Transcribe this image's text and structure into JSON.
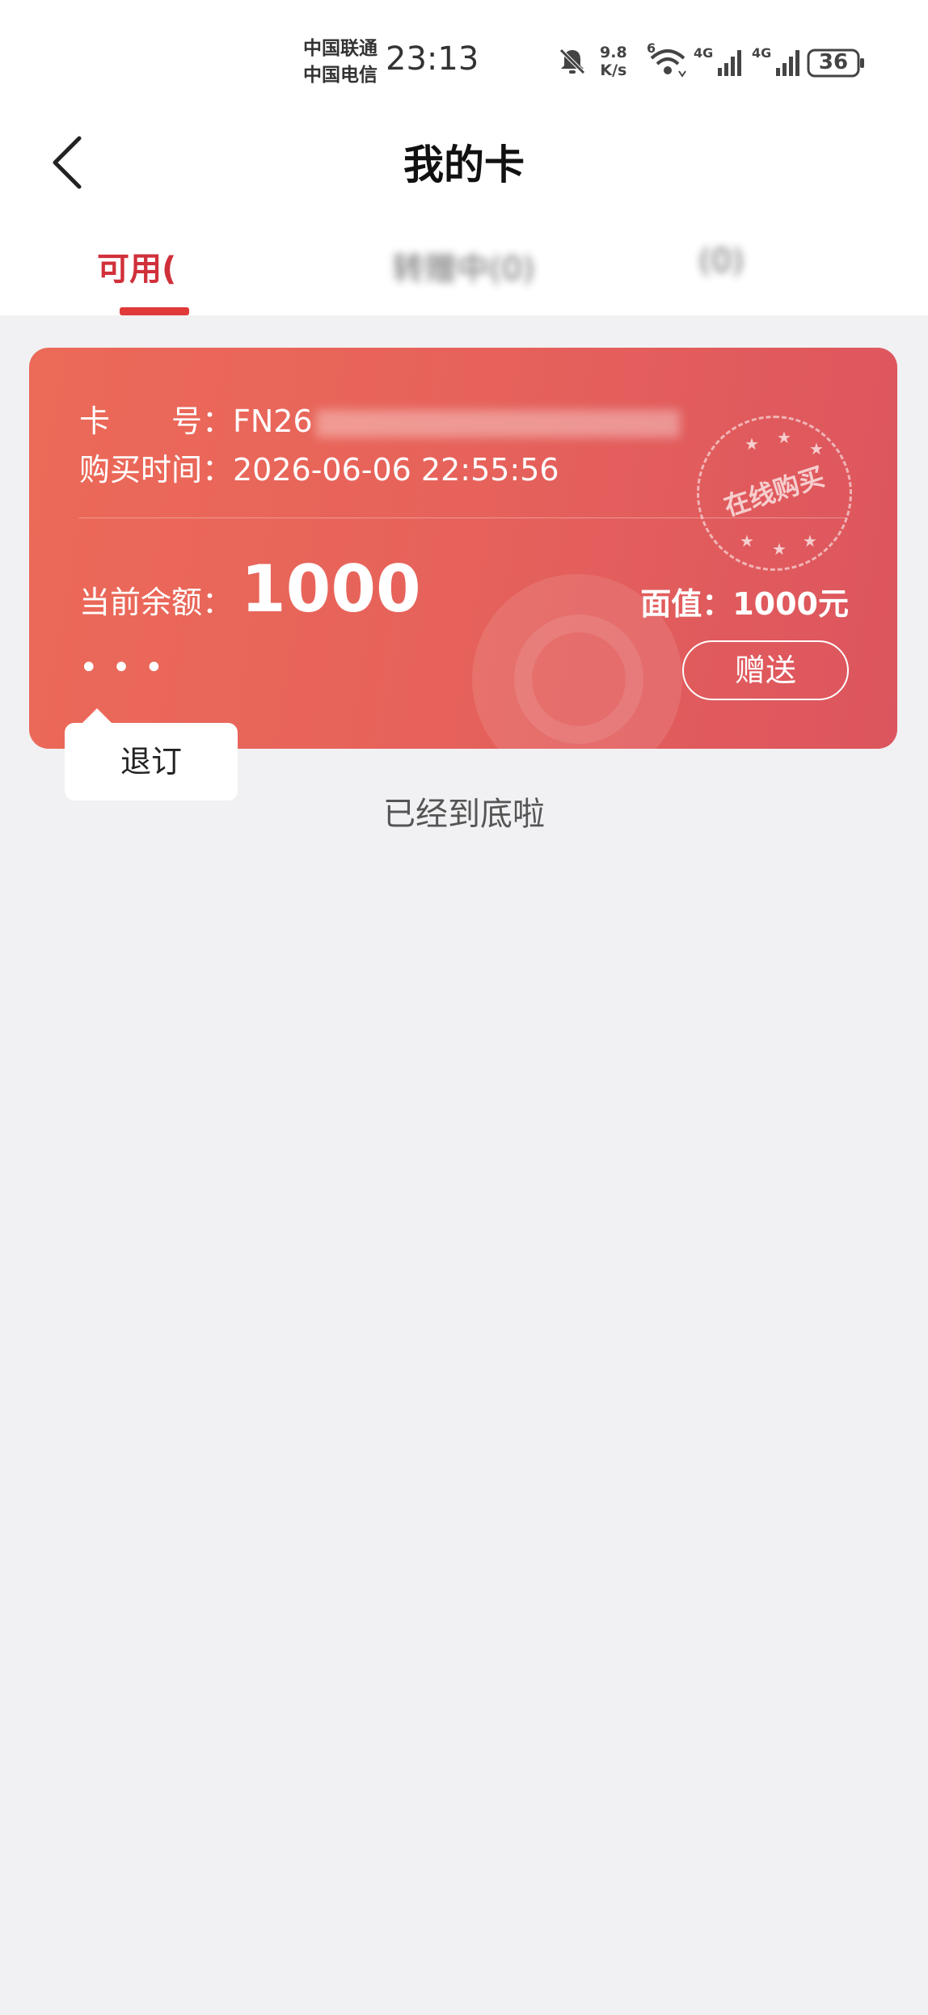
{
  "status_bar": {
    "carrier_1": "中国联通",
    "carrier_2": "中国电信",
    "time": "23:13",
    "net_speed_value": "9.8",
    "net_speed_unit": "K/s",
    "wifi_label": "6",
    "signal_1_label": "4G",
    "signal_2_label": "4G",
    "battery": "36",
    "icons": [
      "bell-muted-icon",
      "wifi-icon",
      "signal-icon",
      "signal-icon",
      "battery-icon"
    ]
  },
  "header": {
    "title": "我的卡",
    "back_icon": "chevron-left-icon"
  },
  "tabs": [
    {
      "label": "可用(",
      "active": true
    },
    {
      "label": "转赠中(0)",
      "active": false
    },
    {
      "label": "(0)",
      "active": false
    }
  ],
  "card": {
    "number_label": "卡　　号：",
    "number_visible": "FN26",
    "purchase_label": "购买时间：",
    "purchase_time": "2026-06-06 22:55:56",
    "balance_label": "当前余额：",
    "balance_value": "1000",
    "face_value": "面值：1000元",
    "gift_button": "赠送",
    "more_label": "• • •",
    "stamp_text": "在线购买",
    "accent_color": "#e6625b"
  },
  "popup": {
    "item": "退订"
  },
  "footer_text": "已经到底啦"
}
